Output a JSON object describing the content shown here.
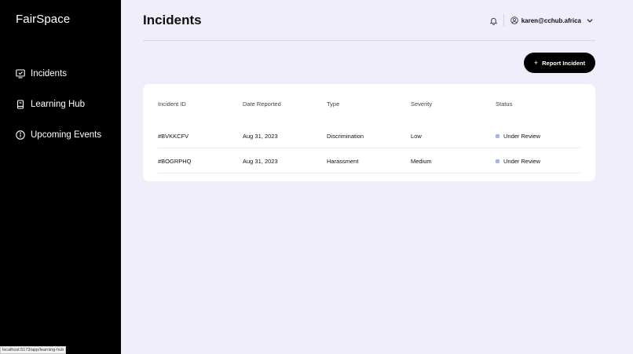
{
  "sidebar": {
    "brand": "FairSpace",
    "items": [
      {
        "label": "Incidents",
        "icon": "incidents-icon"
      },
      {
        "label": "Learning Hub",
        "icon": "book-icon"
      },
      {
        "label": "Upcoming Events",
        "icon": "info-icon"
      }
    ]
  },
  "header": {
    "title": "Incidents",
    "user_email": "karen@cchub.africa"
  },
  "actions": {
    "report_label": "Report Incident"
  },
  "table": {
    "columns": [
      "Incident ID",
      "Date Reported",
      "Type",
      "Severity",
      "Status"
    ],
    "rows": [
      {
        "id": "#BVKKCFV",
        "date": "Aug 31, 2023",
        "type": "Discrimination",
        "severity": "Low",
        "status": "Under Review"
      },
      {
        "id": "#BOGRPHQ",
        "date": "Aug 31, 2023",
        "type": "Harassment",
        "severity": "Medium",
        "status": "Under Review"
      }
    ]
  },
  "statusbar": {
    "url": "localhost:5173/app/learning-hub"
  },
  "colors": {
    "sidebar_bg": "#000000",
    "page_bg": "#f1eefb",
    "status_dot": "#9fb9ec",
    "button_bg": "#000000"
  }
}
